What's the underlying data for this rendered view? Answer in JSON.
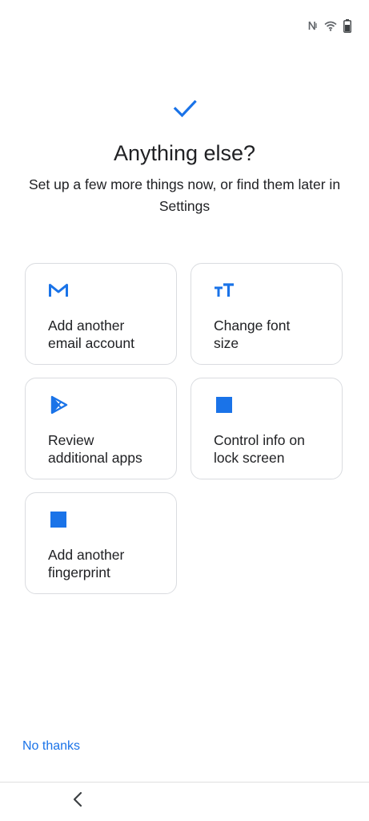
{
  "status_bar": {
    "icons": [
      "nfc-icon",
      "wifi-icon",
      "battery-icon"
    ]
  },
  "header": {
    "icon": "check-icon",
    "title": "Anything else?",
    "subtitle": "Set up a few more things now, or find them later in Settings"
  },
  "options": [
    {
      "icon": "gmail-icon",
      "label_line1": "Add another",
      "label_line2": "email account"
    },
    {
      "icon": "font-size-icon",
      "label_line1": "Change font",
      "label_line2": "size"
    },
    {
      "icon": "play-store-icon",
      "label_line1": "Review",
      "label_line2": "additional apps"
    },
    {
      "icon": "lock-screen-icon",
      "label_line1": "Control info on",
      "label_line2": "lock screen"
    },
    {
      "icon": "fingerprint-icon",
      "label_line1": "Add another",
      "label_line2": "fingerprint"
    }
  ],
  "footer": {
    "no_thanks_label": "No thanks"
  },
  "nav": {
    "back_icon": "back-chevron-icon"
  },
  "colors": {
    "accent": "#1a73e8",
    "text": "#202124",
    "card_border": "#dadce0"
  }
}
